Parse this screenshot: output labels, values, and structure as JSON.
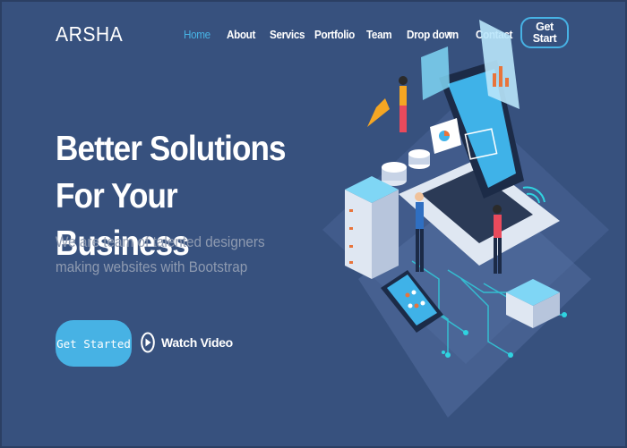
{
  "brand": {
    "logo": "ARSHA"
  },
  "nav": {
    "items": [
      {
        "label": "Home",
        "active": true
      },
      {
        "label": "About"
      },
      {
        "label": "Servics"
      },
      {
        "label": "Portfolio"
      },
      {
        "label": "Team"
      },
      {
        "label": "Drop down"
      },
      {
        "label": "Contact"
      }
    ],
    "cta_label": "Get Start"
  },
  "hero": {
    "title": "Better Solutions For Your Business",
    "subtitle": "We are team of talented designers making websites with Bootstrap",
    "primary_button": "Get Started",
    "video_link": "Watch Video"
  },
  "colors": {
    "background": "#37517e",
    "accent": "#47b2e4",
    "subtitle": "#8e9ab0"
  },
  "icons": {
    "dropdown": "chevron-down-icon",
    "play": "play-circle-icon"
  }
}
